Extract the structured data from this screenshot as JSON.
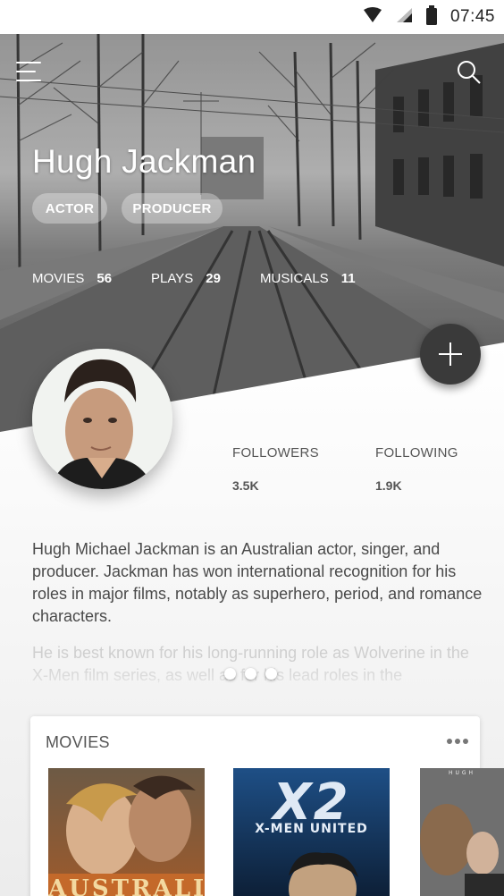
{
  "status_bar": {
    "time": "07:45",
    "icons": [
      "wifi-icon",
      "signal-icon",
      "battery-icon"
    ]
  },
  "header": {
    "menu_icon": "menu-icon",
    "search_icon": "search-icon"
  },
  "profile": {
    "name": "Hugh Jackman",
    "roles": [
      "ACTOR",
      "PRODUCER"
    ],
    "stats": [
      {
        "label": "MOVIES",
        "value": "56"
      },
      {
        "label": "PLAYS",
        "value": "29"
      },
      {
        "label": "MUSICALS",
        "value": "11"
      }
    ],
    "followers": {
      "label": "FOLLOWERS",
      "value": "3.5K"
    },
    "following": {
      "label": "FOLLOWING",
      "value": "1.9K"
    }
  },
  "bio": {
    "paragraph1": "Hugh Michael Jackman is an Australian actor, singer, and producer. Jackman has won international recognition for his roles in major films, notably as superhero, period, and romance characters.",
    "paragraph2": "He is best known for his long-running role as Wolverine in the X-Men film series, as well as for his lead roles in the"
  },
  "movies_section": {
    "title": "MOVIES",
    "posters": [
      {
        "title": "AUSTRALIA"
      },
      {
        "title": "X2",
        "subtitle": "X-MEN UNITED"
      },
      {
        "title": "HUGH"
      }
    ]
  },
  "colors": {
    "fab": "#3a3a3a",
    "background": "#f4f4f4",
    "chip": "#ffffff55"
  }
}
